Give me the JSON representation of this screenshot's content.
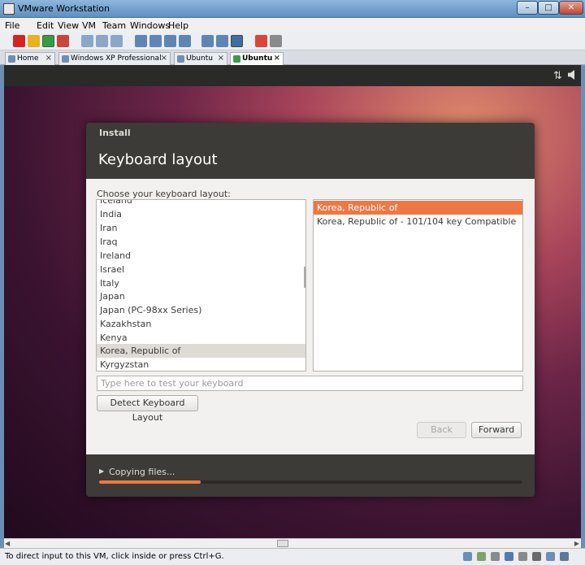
{
  "window": {
    "title": "VMware Workstation",
    "min": "–",
    "max": "□",
    "close": "✕"
  },
  "menu": [
    "File",
    "Edit",
    "View",
    "VM",
    "Team",
    "Windows",
    "Help"
  ],
  "tabs": [
    {
      "label": "Home",
      "close": "×"
    },
    {
      "label": "Windows XP Professional",
      "close": "×"
    },
    {
      "label": "Ubuntu",
      "close": "×"
    },
    {
      "label": "Ubuntu",
      "close": "×"
    }
  ],
  "vm_panel": {
    "net_icon": "⇅"
  },
  "installer": {
    "title": "Install",
    "heading": "Keyboard layout",
    "prompt": "Choose your keyboard layout:",
    "layouts": [
      "Iceland",
      "India",
      "Iran",
      "Iraq",
      "Ireland",
      "Israel",
      "Italy",
      "Japan",
      "Japan (PC-98xx Series)",
      "Kazakhstan",
      "Kenya",
      "Korea, Republic of",
      "Kyrgyzstan"
    ],
    "selected_layout": "Korea, Republic of",
    "variants": [
      "Korea, Republic of",
      "Korea, Republic of - 101/104 key Compatible"
    ],
    "selected_variant": "Korea, Republic of",
    "test_placeholder": "Type here to test your keyboard",
    "detect_button": "Detect Keyboard Layout",
    "back_button": "Back",
    "forward_button": "Forward",
    "progress_label": "Copying files...",
    "progress_arrow": "▶",
    "progress_percent": 24
  },
  "scrollbar": {
    "left": "◀",
    "right": "▶"
  },
  "status": {
    "text": "To direct input to this VM, click inside or press Ctrl+G."
  },
  "colors": {
    "accent": "#ee7744",
    "progress": "#ef7a3a"
  }
}
